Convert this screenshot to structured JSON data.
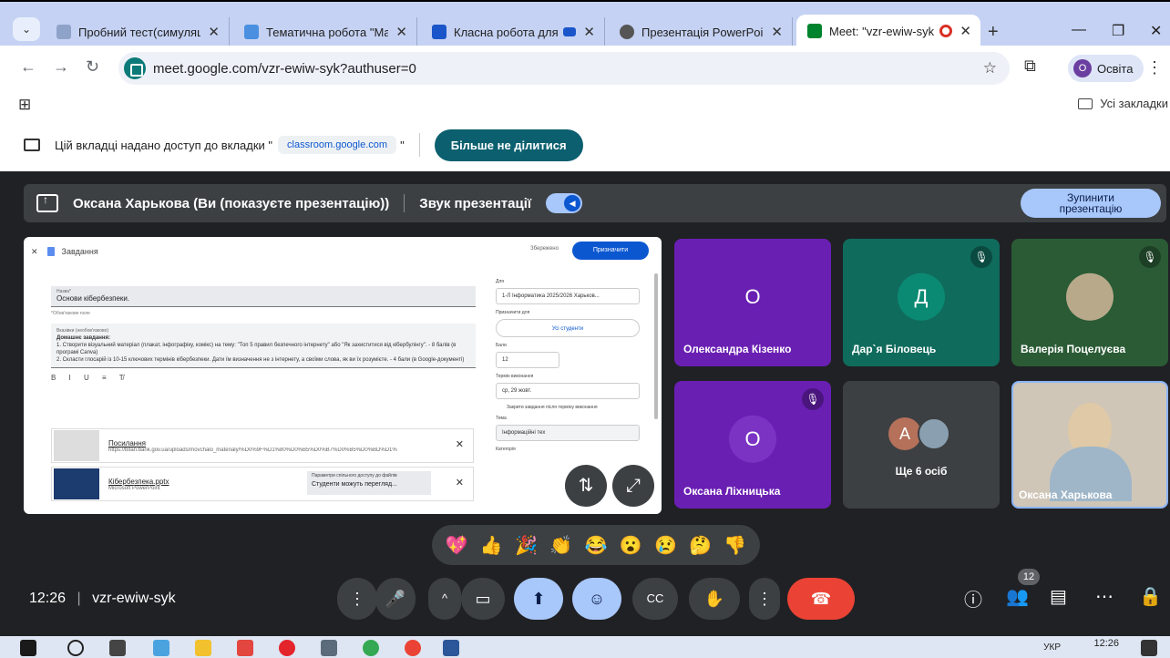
{
  "browser": {
    "tabs": [
      {
        "title": "Пробний тест(симуляці",
        "active": false
      },
      {
        "title": "Тематична робота \"Ма",
        "active": false
      },
      {
        "title": "Класна робота для",
        "active": false
      },
      {
        "title": "Презентація PowerPoint",
        "active": false
      },
      {
        "title": "Meet: \"vzr-ewiw-syk\"",
        "active": true
      }
    ],
    "url": "meet.google.com/vzr-ewiw-syk?authuser=0",
    "profile_initial": "О",
    "profile_label": "Освіта",
    "all_bookmarks": "Усі закладки"
  },
  "share_bar": {
    "text": "Цій вкладці надано доступ до вкладки \"",
    "chip": "classroom.google.com",
    "quote": "\"",
    "stop_label": "Більше не ділитися"
  },
  "presentation": {
    "title": "Оксана Харькова (Ви (показуєте презентацію))",
    "sound_label": "Звук презентації",
    "stop_line1": "Зупинити",
    "stop_line2": "презентацію"
  },
  "shared_screen": {
    "header": "Завдання",
    "saved": "Збережено",
    "assign_button": "Призначити",
    "name_label": "Назва*",
    "name_value": "Основи кібербезпеки.",
    "required_note": "*Обов'язкове поле",
    "instructions_label": "Вказівки (необов'язково)",
    "instructions_heading": "Домашнє завдання:",
    "instructions_1": "1. Створити візуальний матеріал (плакат, інфографіку, комікс) на тему: \"Топ 5 правил безпечного інтернету\" або \"Як захиститися від кібербулінгу\". - 8 балів (в програмі Canva)",
    "instructions_2": "2. Скласти глосарій із 10-15 ключових термінів кібербезпеки. Дати їм визначення не з інтернету, а своїми слова, як ви їх розумієте. - 4 бали (в Google-документі)",
    "format_tools": "B I U ≡ T̸",
    "attachment1_name": "Посилання",
    "attachment1_url": "https://bitan.bank.gov.ua/uploads/movchalo_materialy/%D0%9F%D1%80%D0%B5%D0%B7%D0%B5%D0%BD%D1%",
    "attachment2_name": "Кібербезпека.pptx",
    "attachment2_type": "Microsoft PowerPoint",
    "perm_label": "Параметри спільного доступу до файлів",
    "perm_value": "Студенти можуть перегляд...",
    "side_for": "Для",
    "side_class": "1-Л Інформатика 2025/2026 Харьков...",
    "side_assign_to": "Призначити для",
    "side_all_students": "Усі студенти",
    "side_points": "Бали",
    "side_points_value": "12",
    "side_due": "Термін виконання",
    "side_due_value": "ср, 29 жовт.",
    "side_close": "Закрити завдання після терміну виконання",
    "side_topic": "Тема",
    "side_topic_value": "Інформаційні тех",
    "side_category": "Категорія"
  },
  "participants": [
    {
      "initial": "О",
      "name": "Олександра Кізенко",
      "bg": "#6a1fb3",
      "muted": false
    },
    {
      "initial": "Д",
      "name": "Дар`я Біловець",
      "bg": "#0f6b5c",
      "muted": true
    },
    {
      "initial": "",
      "name": "Валерія Поцелуєва",
      "bg": "#2a5b35",
      "muted": true
    },
    {
      "initial": "О",
      "name": "Оксана Ліхницька",
      "bg": "#6a1fb3",
      "muted": true
    },
    {
      "initial": "A",
      "name": "Ще 6 осіб",
      "bg": "#3c4043",
      "muted": false
    },
    {
      "initial": "",
      "name": "Оксана Харькова",
      "bg": "#cfc6b8",
      "muted": false
    }
  ],
  "reactions": [
    "💖",
    "👍",
    "🎉",
    "👏",
    "😂",
    "😮",
    "😢",
    "🤔",
    "👎"
  ],
  "controls": {
    "time": "12:26",
    "meeting_code": "vzr-ewiw-syk",
    "participant_count": "12"
  },
  "taskbar": {
    "tray": "УКР",
    "time": "12:26"
  },
  "colors": {
    "accent_blue": "#a8c7fa",
    "end_call": "#ea4335",
    "share_button": "#0b5f6e"
  }
}
